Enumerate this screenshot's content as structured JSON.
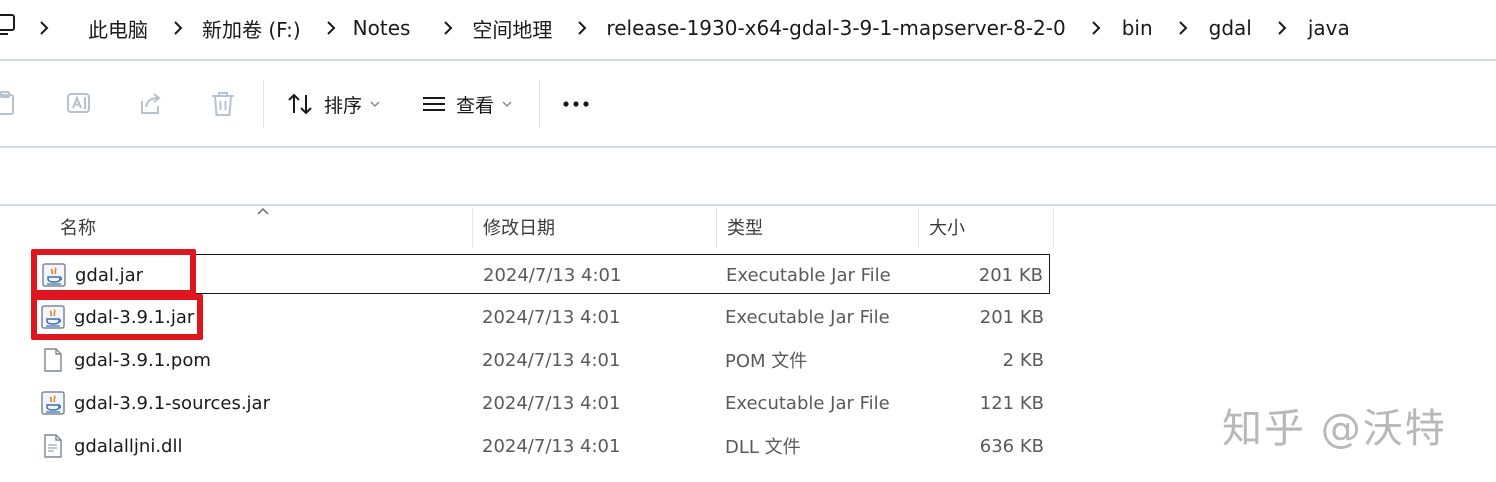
{
  "address_bar": {
    "crumbs": [
      "此电脑",
      "新加卷 (F:)",
      "Notes",
      "空间地理",
      "release-1930-x64-gdal-3-9-1-mapserver-8-2-0",
      "bin",
      "gdal",
      "java"
    ]
  },
  "toolbar": {
    "sort_label": "排序",
    "view_label": "查看",
    "more_label": "···"
  },
  "columns": {
    "name": "名称",
    "date": "修改日期",
    "type": "类型",
    "size": "大小"
  },
  "files": [
    {
      "name": "gdal.jar",
      "date": "2024/7/13 4:01",
      "type": "Executable Jar File",
      "size": "201 KB",
      "icon": "java-jar-icon"
    },
    {
      "name": "gdal-3.9.1.jar",
      "date": "2024/7/13 4:01",
      "type": "Executable Jar File",
      "size": "201 KB",
      "icon": "java-jar-icon"
    },
    {
      "name": "gdal-3.9.1.pom",
      "date": "2024/7/13 4:01",
      "type": "POM 文件",
      "size": "2 KB",
      "icon": "blank-file-icon"
    },
    {
      "name": "gdal-3.9.1-sources.jar",
      "date": "2024/7/13 4:01",
      "type": "Executable Jar File",
      "size": "121 KB",
      "icon": "java-jar-icon"
    },
    {
      "name": "gdalalljni.dll",
      "date": "2024/7/13 4:01",
      "type": "DLL 文件",
      "size": "636 KB",
      "icon": "dll-file-icon"
    }
  ],
  "watermark": "知乎 @沃特",
  "colors": {
    "highlight": "#e0161f",
    "divider": "#cfd8e6"
  }
}
